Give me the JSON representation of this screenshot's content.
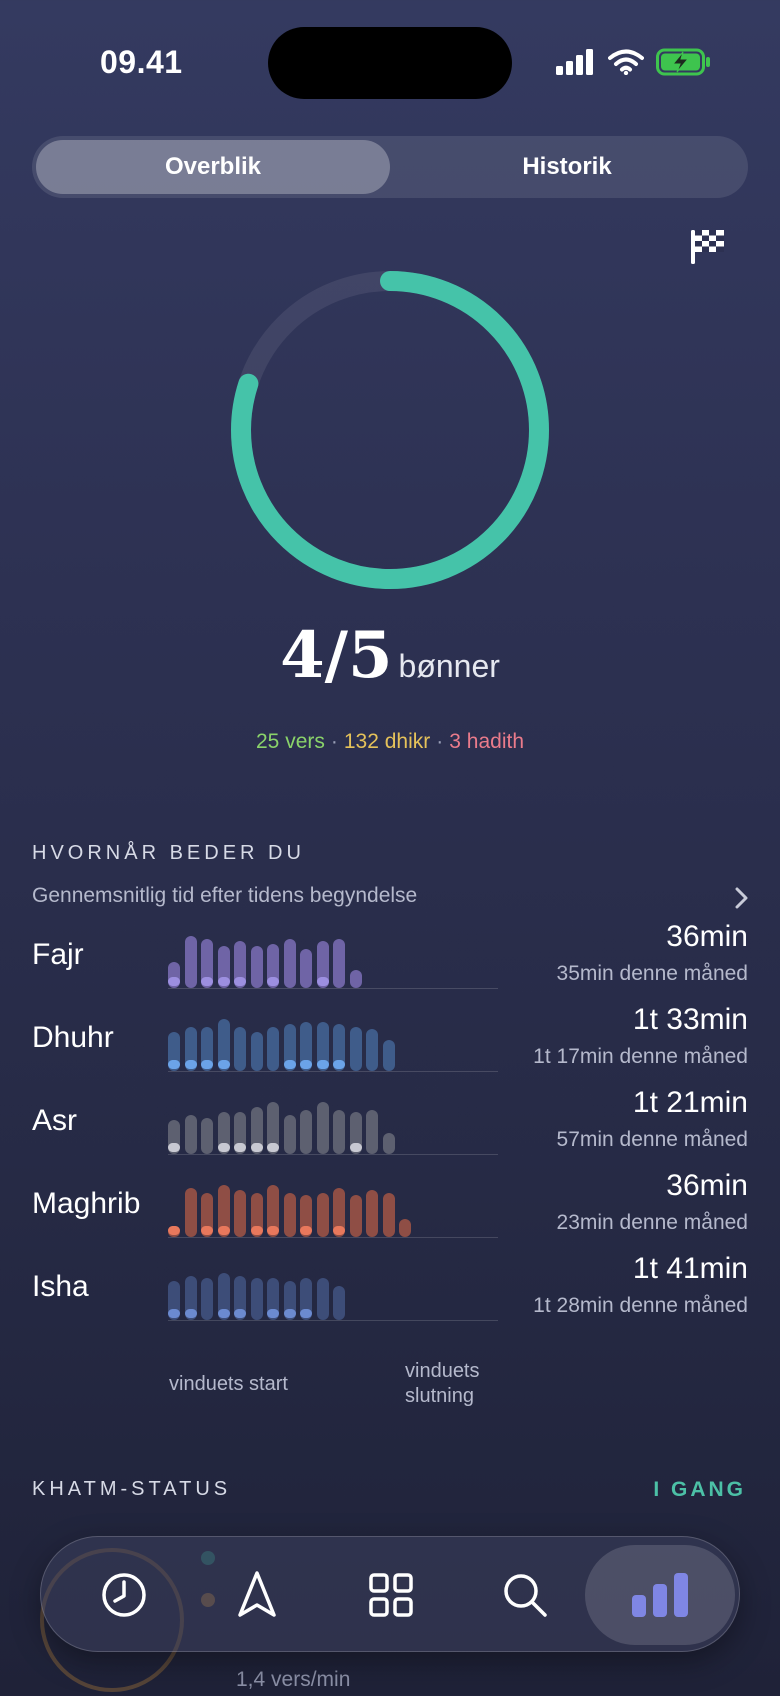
{
  "status_bar": {
    "time": "09.41"
  },
  "segmented": {
    "tabs": [
      {
        "label": "Overblik",
        "active": true
      },
      {
        "label": "Historik",
        "active": false
      }
    ]
  },
  "summary": {
    "count": "4/5",
    "count_label": "bønner",
    "progress_fraction": 0.8,
    "vers": "25 vers",
    "dhikr": "132 dhikr",
    "hadith": "3 hadith",
    "separator": "·"
  },
  "colors": {
    "ring": "#45c3a9",
    "vers": "#8ad36a",
    "dhikr": "#e5c25a",
    "hadith": "#ea7b8b",
    "status": "#4cc0a6"
  },
  "when_section": {
    "title": "HVORNÅR BEDER DU",
    "subtitle": "Gennemsnitlig tid efter tidens begyndelse",
    "axis_start": "vinduets start",
    "axis_end": "vinduets slutning"
  },
  "prayers": [
    {
      "name": "Fajr",
      "avg": "36min",
      "month": "35min denne måned",
      "color": "#6f64a6",
      "dot_color": "#9c8fe0",
      "levels": [
        0.5,
        1.0,
        0.95,
        0.8,
        0.9,
        0.8,
        0.85,
        0.95,
        0.75,
        0.9,
        0.95,
        0.35
      ],
      "dots": [
        1,
        0,
        1,
        1,
        1,
        0,
        1,
        0,
        0,
        1,
        0,
        0
      ]
    },
    {
      "name": "Dhuhr",
      "avg": "1t 33min",
      "month": "1t 17min denne måned",
      "color": "#3f5c8a",
      "dot_color": "#6ba3e8",
      "levels": [
        0.75,
        0.85,
        0.85,
        1.0,
        0.85,
        0.75,
        0.85,
        0.9,
        0.95,
        0.95,
        0.9,
        0.85,
        0.8,
        0.6
      ],
      "dots": [
        1,
        1,
        1,
        1,
        0,
        0,
        0,
        1,
        1,
        1,
        1,
        0,
        0,
        0
      ]
    },
    {
      "name": "Asr",
      "avg": "1t 21min",
      "month": "57min denne måned",
      "color": "#5d6070",
      "dot_color": "#c8c9d2",
      "levels": [
        0.65,
        0.75,
        0.7,
        0.8,
        0.8,
        0.9,
        1.0,
        0.75,
        0.85,
        1.0,
        0.85,
        0.8,
        0.85,
        0.4
      ],
      "dots": [
        1,
        0,
        0,
        1,
        1,
        1,
        1,
        0,
        0,
        0,
        0,
        1,
        0,
        0
      ]
    },
    {
      "name": "Maghrib",
      "avg": "36min",
      "month": "23min denne måned",
      "color": "#8f4e45",
      "dot_color": "#e8785c",
      "levels": [
        0.15,
        0.95,
        0.85,
        1.0,
        0.9,
        0.85,
        1.0,
        0.85,
        0.8,
        0.85,
        0.95,
        0.8,
        0.9,
        0.85,
        0.35
      ],
      "dots": [
        1,
        0,
        1,
        1,
        0,
        1,
        1,
        0,
        1,
        0,
        1,
        0,
        0,
        0,
        0
      ]
    },
    {
      "name": "Isha",
      "avg": "1t 41min",
      "month": "1t 28min denne måned",
      "color": "#3d4d78",
      "dot_color": "#6b8ad0",
      "levels": [
        0.75,
        0.85,
        0.8,
        0.9,
        0.85,
        0.8,
        0.8,
        0.75,
        0.8,
        0.8,
        0.65
      ],
      "dots": [
        1,
        1,
        0,
        1,
        1,
        0,
        1,
        1,
        1,
        0,
        0
      ]
    }
  ],
  "khatm": {
    "title": "KHATM-STATUS",
    "status": "I GANG",
    "rate": "1,4 vers/min"
  },
  "tab_bar": {
    "items": [
      {
        "name": "clock",
        "active": false
      },
      {
        "name": "navigate",
        "active": false
      },
      {
        "name": "grid",
        "active": false
      },
      {
        "name": "search",
        "active": false
      },
      {
        "name": "stats",
        "active": true
      }
    ]
  }
}
